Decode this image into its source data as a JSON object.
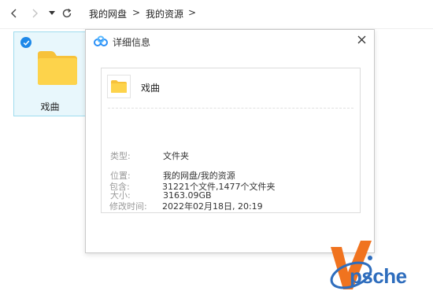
{
  "toolbar": {
    "breadcrumbs": [
      "我的网盘",
      "我的资源"
    ],
    "separator": ">"
  },
  "folder": {
    "name": "戏曲",
    "selected": true
  },
  "dialog": {
    "title": "详细信息",
    "file_name": "戏曲",
    "rows": [
      {
        "label": "类型:",
        "value": "文件夹"
      },
      {
        "label": "位置:",
        "value": "我的网盘/我的资源"
      },
      {
        "label": "大小:",
        "value": "3163.09GB"
      },
      {
        "label": "包含:",
        "value": "31221个文件,1477个文件夹"
      },
      {
        "label": "修改时间:",
        "value": "2022年02月18日, 20:19"
      }
    ]
  },
  "watermark": {
    "text": "Vpsche"
  },
  "colors": {
    "accent": "#1d88e8",
    "folder_yellow": "#fdd34b",
    "watermark_orange": "#f0731f",
    "watermark_blue": "#2e6dbd"
  }
}
